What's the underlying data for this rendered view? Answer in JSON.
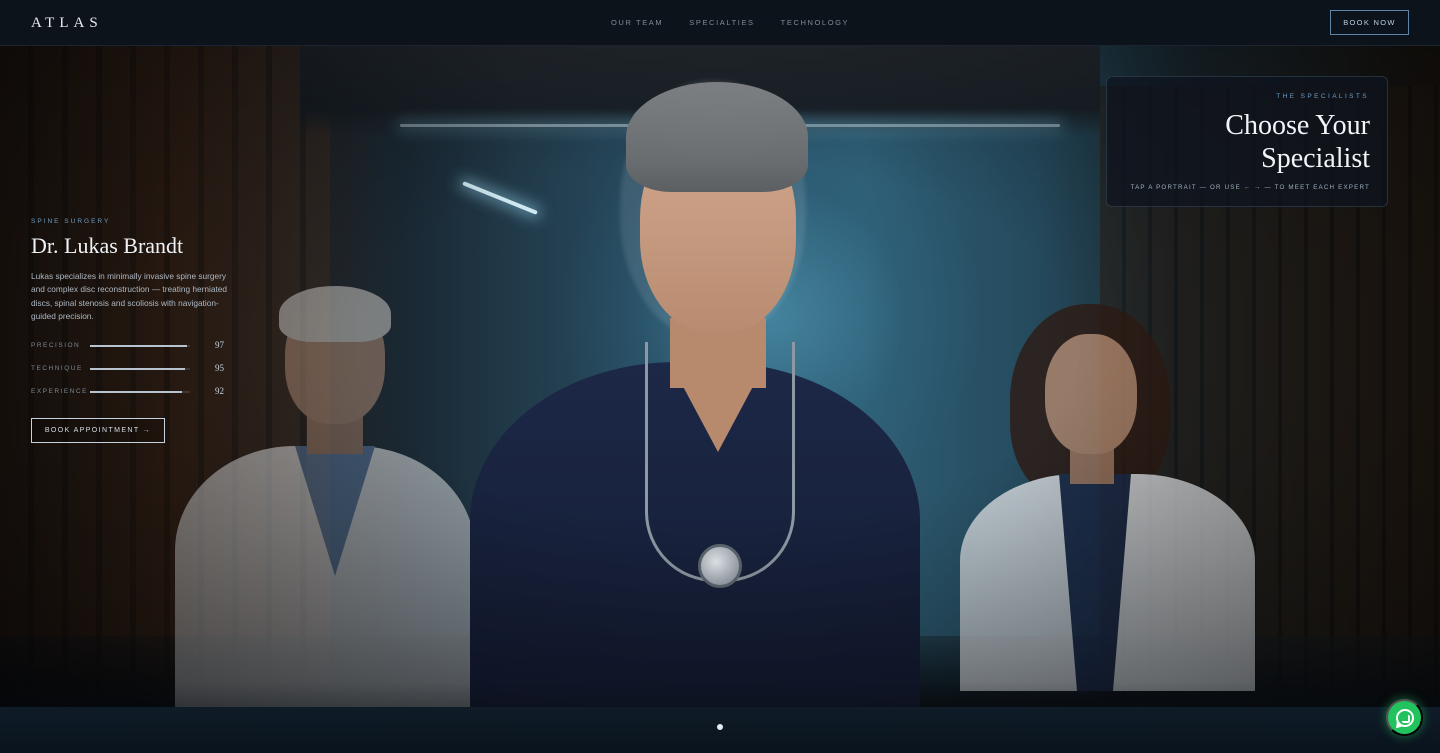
{
  "nav": {
    "logo": "ATLAS",
    "links": [
      "OUR TEAM",
      "SPECIALTIES",
      "TECHNOLOGY"
    ],
    "cta": "BOOK NOW"
  },
  "specialist": {
    "specialty": "SPINE SURGERY",
    "name": "Dr. Lukas Brandt",
    "bio": "Lukas specializes in minimally invasive spine surgery and complex disc reconstruction — treating herniated discs, spinal stenosis and scoliosis with navigation-guided precision.",
    "stats": [
      {
        "label": "PRECISION",
        "value": "97",
        "level": 0.97
      },
      {
        "label": "TECHNIQUE",
        "value": "95",
        "level": 0.95
      },
      {
        "label": "EXPERIENCE",
        "value": "92",
        "level": 0.92
      }
    ],
    "book_label": "BOOK APPOINTMENT →"
  },
  "card": {
    "eyebrow": "THE SPECIALISTS",
    "title": "Choose Your Specialist",
    "hint": "TAP A PORTRAIT — OR USE ← → — TO MEET EACH EXPERT"
  },
  "carousel": {
    "active_index": 0,
    "count": 1
  },
  "colors": {
    "accent": "#6e9ec4",
    "whatsapp": "#22c35e",
    "background": "#0b0f16"
  },
  "icons": {
    "chat": "whatsapp-icon"
  }
}
